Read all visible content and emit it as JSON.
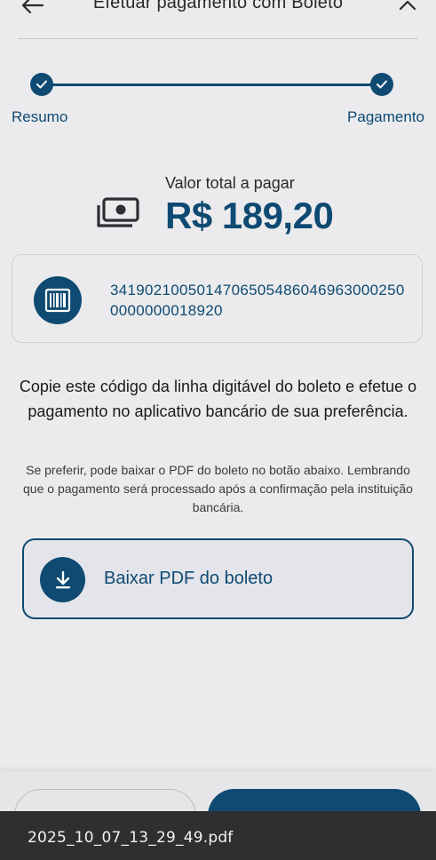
{
  "header": {
    "title": "Efetuar pagamento com Boleto",
    "back_icon": "arrow-left-icon",
    "collapse_icon": "chevron-up-icon"
  },
  "stepper": {
    "steps": [
      {
        "label": "Resumo",
        "state": "completed"
      },
      {
        "label": "Pagamento",
        "state": "completed"
      }
    ]
  },
  "summary": {
    "caption": "Valor total a pagar",
    "amount": "R$ 189,20",
    "icon": "money-icon"
  },
  "boleto": {
    "icon": "barcode-icon",
    "code": "34190210050147065054860469630002500000000018920"
  },
  "instructions": {
    "main": "Copie este código da linha digitável do boleto e efetue o pagamento no aplicativo bancário de sua preferência.",
    "note": "Se preferir, pode baixar o PDF do boleto no botão abaixo. Lembrando que o pagamento será processado após a confirmação pela instituição bancária."
  },
  "download": {
    "label": "Baixar PDF do boleto",
    "icon": "download-icon"
  },
  "file_bar": {
    "filename": "2025_10_07_13_29_49.pdf"
  },
  "colors": {
    "brand": "#0e4a72",
    "background": "#ebebed",
    "file_bar": "#2e2f31"
  }
}
